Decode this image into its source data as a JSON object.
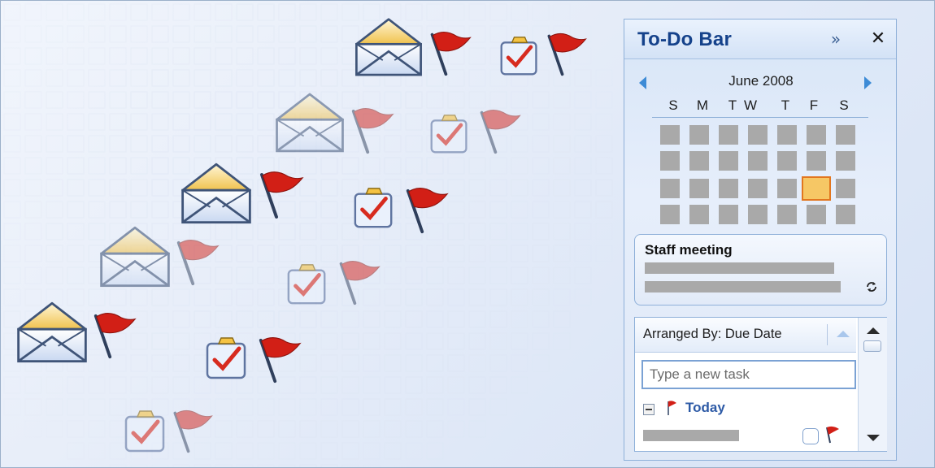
{
  "todo_bar": {
    "title": "To-Do Bar",
    "expand_glyph": "»",
    "close_glyph": "✕"
  },
  "calendar": {
    "month_label": "June 2008",
    "day_headers": [
      "S",
      "M",
      "T",
      "W",
      "T",
      "F",
      "S"
    ],
    "weeks": 4,
    "highlighted_cell": {
      "week": 3,
      "weekday": 6
    }
  },
  "appointment": {
    "title": "Staff meeting",
    "recurring_icon": "recurrence-icon"
  },
  "tasks": {
    "arranged_by_label": "Arranged By: Due Date",
    "new_task_placeholder": "Type a new task",
    "group_label": "Today",
    "group_icon": "red-flag-icon"
  },
  "decor": {
    "envelope_icon": "mail-envelope-icon",
    "task_icon": "task-clipboard-icon",
    "flag_icon": "red-flag-icon",
    "colors": {
      "title_blue": "#15428b",
      "group_blue": "#2d5aa6",
      "flag_red": "#d21f16",
      "today_fill": "#f6c765",
      "today_border": "#e2761f"
    }
  }
}
